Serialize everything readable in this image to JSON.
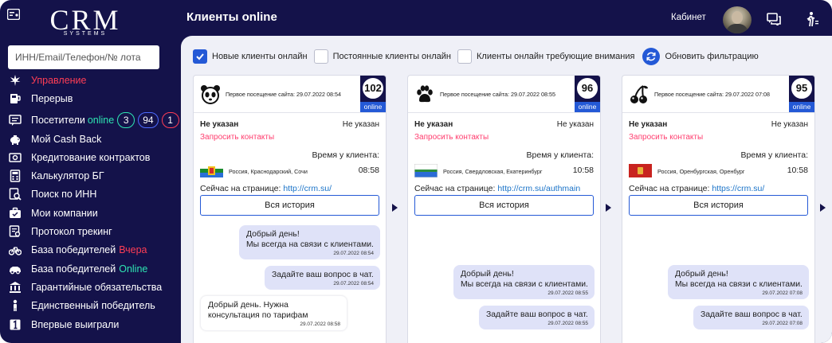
{
  "sidebar": {
    "search_placeholder": "ИНН/Email/Телефон/№ лота",
    "logo_text": "CRM",
    "logo_sub": "SYSTEMS",
    "items": [
      {
        "label": "Управление",
        "icon": "leaf-icon"
      },
      {
        "label": "Перерыв",
        "icon": "coffee-icon"
      },
      {
        "label": "Посетители",
        "extra": "online",
        "icon": "chat-list-icon",
        "badges": [
          "3",
          "94",
          "1"
        ]
      },
      {
        "label": "Мой Cash Back",
        "icon": "piggy-bank-icon"
      },
      {
        "label": "Кредитование контрактов",
        "icon": "money-icon"
      },
      {
        "label": "Калькулятор БГ",
        "icon": "calculator-icon"
      },
      {
        "label": "Поиск по ИНН",
        "icon": "search-doc-icon"
      },
      {
        "label": "Мои компании",
        "icon": "briefcase-icon"
      },
      {
        "label": "Протокол трекинг",
        "icon": "protocol-icon"
      },
      {
        "label": "База победителей",
        "extra": "Вчера",
        "icon": "bicycle-icon"
      },
      {
        "label": "База победителей",
        "extra": "Online",
        "icon": "car-icon"
      },
      {
        "label": "Гарантийные обязательства",
        "icon": "bank-icon"
      },
      {
        "label": "Единственный победитель",
        "icon": "person-icon"
      },
      {
        "label": "Впервые выиграли",
        "icon": "number-one-icon"
      }
    ]
  },
  "header": {
    "title": "Клиенты online",
    "cabinet": "Кабинет"
  },
  "filters": {
    "new_clients": "Новые клиенты онлайн",
    "regular_clients": "Постоянные клиенты онлайн",
    "attention_clients": "Клиенты онлайн требующие внимания",
    "refresh": "Обновить фильтрацию",
    "new_checked": true
  },
  "common": {
    "not_specified": "Не указан",
    "request_contacts": "Запросить контакты",
    "time_label": "Время у клиента:",
    "current_page_label": "Сейчас на странице:",
    "history_button": "Вся история",
    "online": "online"
  },
  "cards": [
    {
      "avatar_icon": "panda-icon",
      "visit": "Первое посещение сайта: 29.07.2022 08:54",
      "score": "102",
      "location": "Россия, Краснодарский, Сочи",
      "time": "08:58",
      "url": "http://crm.su/",
      "flag": {
        "top": "#ffffff",
        "middle": "#1a8c2e",
        "bottom": "#2a6fd6"
      },
      "messages": [
        {
          "from": "operator",
          "text": "Добрый день!\nМы всегда на связи с клиентами.",
          "time": "29.07.2022 08:54"
        },
        {
          "from": "operator",
          "text": "Задайте ваш вопрос в чат.",
          "time": "29.07.2022 08:54"
        },
        {
          "from": "client",
          "text": "Добрый день. Нужна\nконсультация по тарифам",
          "time": "29.07.2022 08:58"
        }
      ]
    },
    {
      "avatar_icon": "paw-icon",
      "visit": "Первое посещение сайта: 29.07.2022 08:55",
      "score": "96",
      "location": "Россия, Свердловская, Екатеринбург",
      "time": "10:58",
      "url": "http://crm.su/authmain",
      "flag": {
        "top": "#ffffff",
        "middle": "#2d8e3c",
        "bottom": "#2b6cd6"
      },
      "messages": [
        {
          "from": "operator",
          "text": "Добрый день!\nМы всегда на связи с клиентами.",
          "time": "29.07.2022 08:55"
        },
        {
          "from": "operator",
          "text": "Задайте ваш вопрос в чат.",
          "time": "29.07.2022 08:55"
        }
      ]
    },
    {
      "avatar_icon": "cherry-icon",
      "visit": "Первое посещение сайта: 29.07.2022 07:08",
      "score": "95",
      "location": "Россия, Оренбургская, Оренбург",
      "time": "10:58",
      "url": "https://crm.su/",
      "flag": {
        "top": "#c8231f",
        "middle": "#c8231f",
        "bottom": "#c8231f"
      },
      "messages": [
        {
          "from": "operator",
          "text": "Добрый день!\nМы всегда на связи с клиентами.",
          "time": "29.07.2022 07:08"
        },
        {
          "from": "operator",
          "text": "Задайте ваш вопрос в чат.",
          "time": "29.07.2022 07:08"
        }
      ]
    }
  ]
}
